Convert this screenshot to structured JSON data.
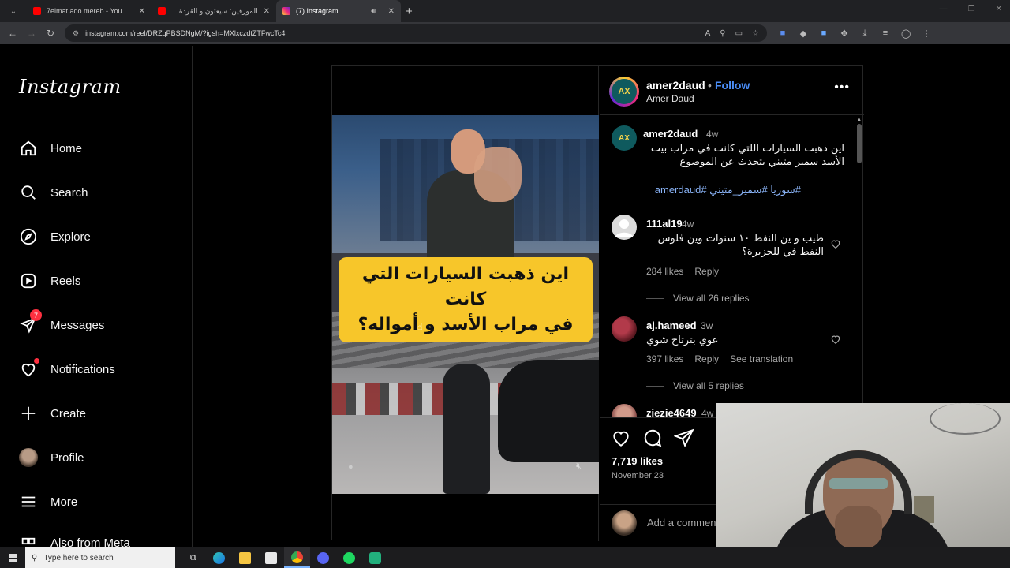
{
  "browser": {
    "tabs": [
      {
        "title": "7elmat ado mereb - YouTube",
        "icon": "youtube-icon",
        "color": "#ff0000"
      },
      {
        "title": "المورفين: سيعتون و القردة يحال",
        "icon": "youtube-icon",
        "color": "#ff0000"
      },
      {
        "title": "(7) Instagram",
        "icon": "instagram-icon",
        "color": "#d6249f",
        "active": true
      }
    ],
    "new_tab": "+",
    "url": "instagram.com/reel/DRZqPBSDNgM/?igsh=MXlxczdtZTFwcTc4"
  },
  "sidebar": {
    "logo": "Instagram",
    "items": [
      {
        "label": "Home",
        "icon": "home-icon"
      },
      {
        "label": "Search",
        "icon": "search-icon"
      },
      {
        "label": "Explore",
        "icon": "explore-compass-icon"
      },
      {
        "label": "Reels",
        "icon": "reels-icon"
      },
      {
        "label": "Messages",
        "icon": "messenger-icon",
        "badge": "7"
      },
      {
        "label": "Notifications",
        "icon": "heart-icon"
      },
      {
        "label": "Create",
        "icon": "plus-icon"
      },
      {
        "label": "Profile",
        "icon": "profile-avatar"
      },
      {
        "label": "More",
        "icon": "menu-icon"
      },
      {
        "label": "Also from Meta",
        "icon": "meta-icon"
      }
    ]
  },
  "video": {
    "caption_line1": "اين ذهبت السيارات التي كانت",
    "caption_line2": "في مراب الأسد و أمواله؟"
  },
  "post": {
    "avatar_text": "AX",
    "username": "amer2daud",
    "separator": "•",
    "follow": "Follow",
    "fullname": "Amer Daud",
    "more": "•••",
    "caption": {
      "username": "amer2daud",
      "time": "4w",
      "text": "اين ذهبت السيارات اللتي كانت في مراب بيت الأسد سمير متيني يتحدث عن الموضوع",
      "tags": "#سوريا #سمير_متيني #amerdaud"
    },
    "comments": [
      {
        "username": "111al19",
        "time": "4w",
        "text": "طيب و ين النفط ١٠ سنوات وين فلوس النفط في للجزيرة؟",
        "likes": "284 likes",
        "reply": "Reply",
        "view_replies": "View all 26 replies"
      },
      {
        "username": "aj.hameed",
        "time": "3w",
        "text": "عوي بترتاح شوي",
        "likes": "397 likes",
        "reply": "Reply",
        "see_translation": "See translation",
        "view_replies": "View all 5 replies"
      },
      {
        "username": "ziezie4649",
        "time": "4w"
      }
    ],
    "likes_count": "7,719 likes",
    "date": "November 23",
    "add_comment_placeholder": "Add a comment..."
  },
  "taskbar": {
    "search_placeholder": "Type here to search"
  }
}
